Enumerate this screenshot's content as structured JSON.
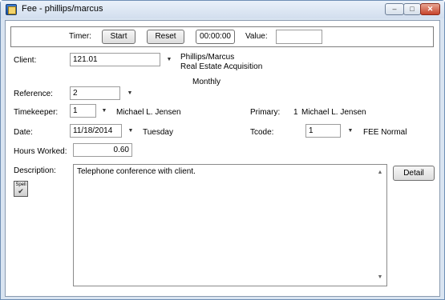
{
  "window": {
    "title": "Fee - phillips/marcus"
  },
  "timer": {
    "label": "Timer:",
    "start_label": "Start",
    "reset_label": "Reset",
    "elapsed": "00:00:00",
    "value_label": "Value:",
    "value": ""
  },
  "client": {
    "label": "Client:",
    "value": "121.01",
    "name": "Phillips/Marcus",
    "matter": "Real Estate Acquisition",
    "billing": "Monthly"
  },
  "reference": {
    "label": "Reference:",
    "value": "2"
  },
  "timekeeper": {
    "label": "Timekeeper:",
    "value": "1",
    "name": "Michael L. Jensen"
  },
  "primary": {
    "label": "Primary:",
    "value": "1",
    "name": "Michael L. Jensen"
  },
  "date": {
    "label": "Date:",
    "value": "11/18/2014",
    "weekday": "Tuesday"
  },
  "tcode": {
    "label": "Tcode:",
    "value": "1",
    "name": "FEE Normal"
  },
  "hours": {
    "label": "Hours Worked:",
    "value": "0.60"
  },
  "description": {
    "label": "Description:",
    "text": "Telephone conference with client.",
    "spell_label": "Spell",
    "detail_label": "Detail"
  },
  "icons": [
    "app-icon",
    "minimize-icon",
    "maximize-icon",
    "close-icon",
    "dropdown-arrow-icon",
    "spell-check-icon",
    "scroll-up-icon",
    "scroll-down-icon"
  ]
}
